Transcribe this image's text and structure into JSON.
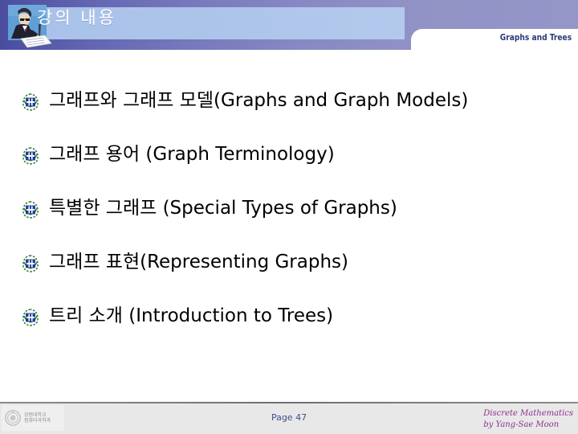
{
  "header": {
    "title": "강의 내용",
    "section_label": "Graphs and Trees",
    "clipart_name": "person-writing-clipart",
    "plate_color": "#a9c2e9",
    "band_color_left": "#4a4d9e",
    "band_color_right": "#9193c6",
    "section_label_color": "#2b3a7a"
  },
  "body": {
    "bullets": [
      {
        "text": "그래프와 그래프 모델(Graphs and Graph Models)",
        "marker": "crest-bullet-icon"
      },
      {
        "text": "그래프 용어 (Graph Terminology)",
        "marker": "crest-bullet-icon"
      },
      {
        "text": "특별한 그래프 (Special Types of Graphs)",
        "marker": "crest-bullet-icon"
      },
      {
        "text": "그래프 표현(Representing Graphs)",
        "marker": "crest-bullet-icon"
      },
      {
        "text": "트리 소개 (Introduction to Trees)",
        "marker": "crest-bullet-icon"
      }
    ],
    "text_color": "#000000",
    "bullet_emblem_blue": "#1c3f9e",
    "bullet_emblem_green": "#2f7d32"
  },
  "footer": {
    "page_label": "Page 47",
    "page_color": "#414f8f",
    "course_title": "Discrete Mathematics",
    "course_author": "by Yang-Sae Moon",
    "course_color": "#8e2f8e",
    "logo_line1": "강원대학교",
    "logo_line2": "컴퓨터과학과",
    "logo_name": "university-logo"
  }
}
